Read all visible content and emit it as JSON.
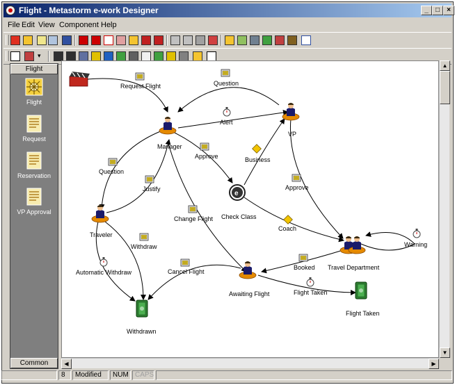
{
  "window": {
    "title": "Flight - Metastorm e-work Designer"
  },
  "menu": [
    "File",
    "Edit",
    "View",
    "Component",
    "Help"
  ],
  "left_panel": {
    "header": "Flight",
    "items": [
      {
        "label": "Flight",
        "icon": "flight-map-icon"
      },
      {
        "label": "Request",
        "icon": "form-icon"
      },
      {
        "label": "Reservation",
        "icon": "form-icon"
      },
      {
        "label": "VP Approval",
        "icon": "form-icon"
      }
    ],
    "footer": "Common"
  },
  "diagram": {
    "stages": {
      "manager": "Manager",
      "vp": "VP",
      "traveler": "Traveler",
      "travel_department": "Travel Department",
      "awaiting_flight": "Awaiting Flight",
      "check_class": "Check Class",
      "withdrawn": "Withdrawn",
      "flight_taken": "Flight Taken"
    },
    "actions": {
      "request_flight": "Request Flight",
      "question_top": "Question",
      "alert": "Alert",
      "approve_manager": "Approve",
      "business": "Business",
      "approve_vp": "Approve",
      "question_left": "Question",
      "justify": "Justify",
      "change_flight": "Change Flight",
      "coach": "Coach",
      "warning": "Warning",
      "withdraw": "Withdraw",
      "automatic_withdraw": "Automatic Withdraw",
      "cancel_flight": "Cancel Flight",
      "booked": "Booked",
      "flight_taken_action": "Flight Taken"
    }
  },
  "status_bar": {
    "count": "8",
    "modified": "Modified",
    "num": "NUM",
    "caps": "CAPS"
  }
}
